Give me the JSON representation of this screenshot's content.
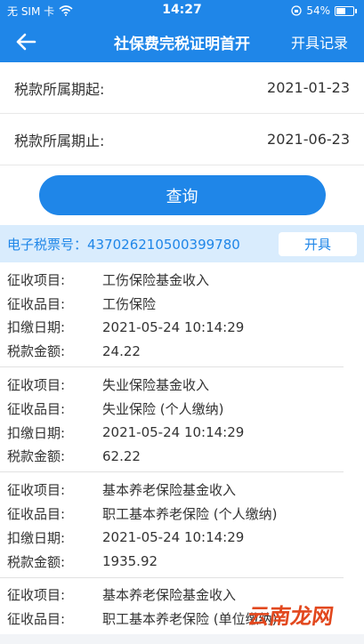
{
  "status": {
    "carrier": "无 SIM 卡",
    "time": "14:27",
    "battery": "54%"
  },
  "nav": {
    "title": "社保费完税证明首开",
    "action": "开具记录"
  },
  "filters": [
    {
      "label": "税款所属期起:",
      "value": "2021-01-23"
    },
    {
      "label": "税款所属期止:",
      "value": "2021-06-23"
    }
  ],
  "query_label": "查询",
  "ticket": {
    "text": "电子税票号：437026210500399780",
    "button": "开具"
  },
  "records": [
    {
      "rows": [
        {
          "label": "征收项目:",
          "value": "工伤保险基金收入"
        },
        {
          "label": "征收品目:",
          "value": "工伤保险"
        },
        {
          "label": "扣缴日期:",
          "value": "2021-05-24 10:14:29"
        },
        {
          "label": "税款金额:",
          "value": "24.22"
        }
      ]
    },
    {
      "rows": [
        {
          "label": "征收项目:",
          "value": "失业保险基金收入"
        },
        {
          "label": "征收品目:",
          "value": "失业保险 (个人缴纳)"
        },
        {
          "label": "扣缴日期:",
          "value": "2021-05-24 10:14:29"
        },
        {
          "label": "税款金额:",
          "value": "62.22"
        }
      ]
    },
    {
      "rows": [
        {
          "label": "征收项目:",
          "value": "基本养老保险基金收入"
        },
        {
          "label": "征收品目:",
          "value": "职工基本养老保险 (个人缴纳)"
        },
        {
          "label": "扣缴日期:",
          "value": "2021-05-24 10:14:29"
        },
        {
          "label": "税款金额:",
          "value": "1935.92"
        }
      ]
    },
    {
      "rows": [
        {
          "label": "征收项目:",
          "value": "基本养老保险基金收入"
        },
        {
          "label": "征收品目:",
          "value": "职工基本养老保险 (单位缴纳)"
        }
      ]
    }
  ],
  "watermark": "云南龙网",
  "colors": {
    "primary": "#1f86e8",
    "ticket_bg": "#d9ecfd",
    "watermark": "#e2481e"
  }
}
